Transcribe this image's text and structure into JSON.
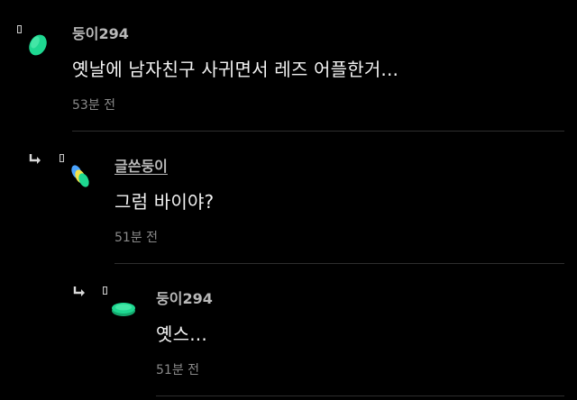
{
  "comments": [
    {
      "author": "둥이294",
      "text": "옛날에 남자친구 사귀면서 레즈 어플한거...",
      "time": "53분 전",
      "avatar": "green-tilted-disc-icon"
    },
    {
      "author": "글쓴둥이",
      "text": "그럼 바이야?",
      "time": "51분 전",
      "avatar": "green-stacked-discs-icon"
    },
    {
      "author": "둥이294",
      "text": "옛스...",
      "time": "51분 전",
      "avatar": "green-flat-disc-icon"
    }
  ],
  "colors": {
    "background": "#000000",
    "text": "#f2f2f2",
    "author": "#b9b9b9",
    "time": "#8a8a8a",
    "divider": "#2e2e2e",
    "avatar_green": "#1ed891"
  }
}
